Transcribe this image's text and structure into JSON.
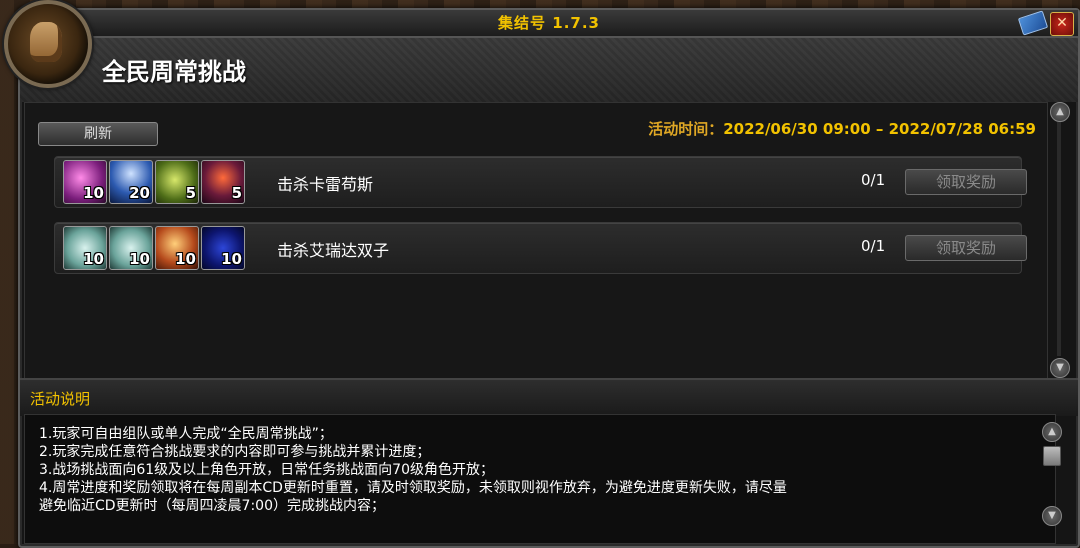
{
  "window": {
    "title": "集结号 1.7.3",
    "close_label": "✕"
  },
  "header": {
    "page_title": "全民周常挑战"
  },
  "toolbar": {
    "refresh_label": "刷新",
    "event_time_label": "活动时间：",
    "event_time_value": "2022/06/30 09:00 – 2022/07/28 06:59"
  },
  "challenges": [
    {
      "name": "击杀卡雷苟斯",
      "progress": "0/1",
      "claim_label": "领取奖励",
      "rewards": [
        {
          "icon": "purple-potion-icon",
          "count": "10",
          "style": "r-pink"
        },
        {
          "icon": "blue-tent-icon",
          "count": "20",
          "style": "r-blue"
        },
        {
          "icon": "green-goblin-icon",
          "count": "5",
          "style": "r-green"
        },
        {
          "icon": "demon-lord-icon",
          "count": "5",
          "style": "r-demon"
        }
      ]
    },
    {
      "name": "击杀艾瑞达双子",
      "progress": "0/1",
      "claim_label": "领取奖励",
      "rewards": [
        {
          "icon": "scroll-icon",
          "count": "10",
          "style": "r-scroll"
        },
        {
          "icon": "scroll-icon",
          "count": "10",
          "style": "r-scroll"
        },
        {
          "icon": "fire-flask-icon",
          "count": "10",
          "style": "r-flask"
        },
        {
          "icon": "void-orb-icon",
          "count": "10",
          "style": "r-void"
        }
      ]
    }
  ],
  "description": {
    "title": "活动说明",
    "lines": [
      "1.玩家可自由组队或单人完成“全民周常挑战”；",
      "2.玩家完成任意符合挑战要求的内容即可参与挑战并累计进度；",
      "3.战场挑战面向61级及以上角色开放，日常任务挑战面向70级角色开放；",
      "4.周常进度和奖励领取将在每周副本CD更新时重置，请及时领取奖励，未领取则视作放弃，为避免进度更新失败，请尽量",
      "避免临近CD更新时（每周四凌晨7:00）完成挑战内容；"
    ]
  },
  "colors": {
    "title_gold": "#f2c200",
    "event_label": "#e0a825",
    "close_red": "#c8281b"
  }
}
